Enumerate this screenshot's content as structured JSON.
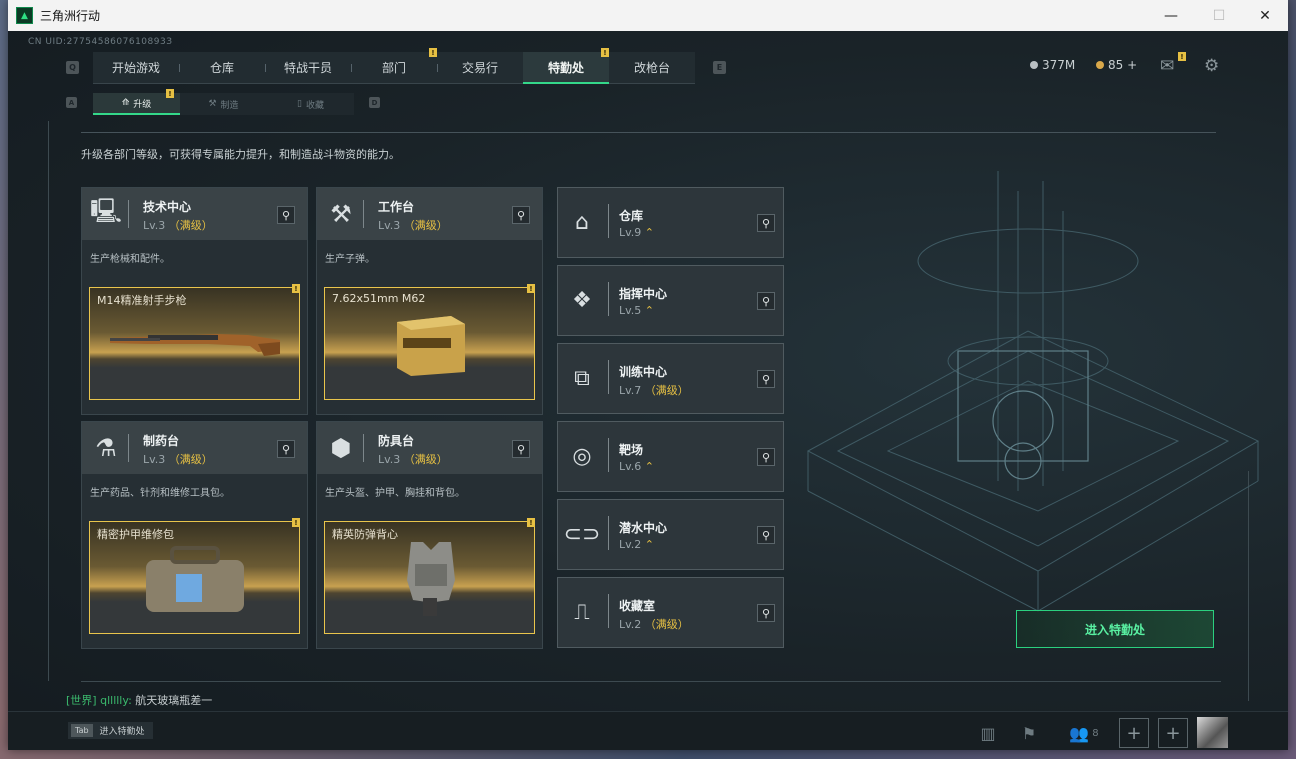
{
  "window": {
    "title": "三角洲行动",
    "controls": {
      "minimize": "—",
      "maximize": "☐",
      "close": "✕"
    }
  },
  "uid": "CN UID:2775458607610893З",
  "top_nav": {
    "left_key": "Q",
    "right_key": "E",
    "tabs": [
      {
        "label": "开始游戏",
        "active": false,
        "badge": ""
      },
      {
        "label": "仓库",
        "active": false,
        "badge": ""
      },
      {
        "label": "特战干员",
        "active": false,
        "badge": ""
      },
      {
        "label": "部门",
        "active": false,
        "badge": "!"
      },
      {
        "label": "交易行",
        "active": false,
        "badge": ""
      },
      {
        "label": "特勤处",
        "active": true,
        "badge": "!"
      },
      {
        "label": "改枪台",
        "active": false,
        "badge": ""
      }
    ]
  },
  "sub_nav": {
    "left_key": "A",
    "right_key": "D",
    "tabs": [
      {
        "label": "升级",
        "active": true,
        "badge": "!"
      },
      {
        "label": "制造",
        "active": false
      },
      {
        "label": "收藏",
        "active": false
      }
    ]
  },
  "currency": {
    "coins": "377M",
    "tokens": "85 +"
  },
  "mail_badge": "!",
  "description": "升级各部门等级，可获得专属能力提升，和制造战斗物资的能力。",
  "workshops": [
    {
      "name": "技术中心",
      "level": "Lv.3",
      "max_label": "（满级）",
      "desc": "生产枪械和配件。",
      "product": "M14精准射手步枪",
      "badge": "!"
    },
    {
      "name": "工作台",
      "level": "Lv.3",
      "max_label": "（满级）",
      "desc": "生产子弹。",
      "product": "7.62x51mm M62",
      "badge": "!"
    },
    {
      "name": "制药台",
      "level": "Lv.3",
      "max_label": "（满级）",
      "desc": "生产药品、针剂和维修工具包。",
      "product": "精密护甲维修包",
      "badge": "!"
    },
    {
      "name": "防具台",
      "level": "Lv.3",
      "max_label": "（满级）",
      "desc": "生产头盔、护甲、胸挂和背包。",
      "product": "精英防弹背心",
      "badge": "!"
    }
  ],
  "facilities": [
    {
      "name": "仓库",
      "level": "Lv.9",
      "suffix": "⌃"
    },
    {
      "name": "指挥中心",
      "level": "Lv.5",
      "suffix": "⌃"
    },
    {
      "name": "训练中心",
      "level": "Lv.7",
      "suffix": "（满级）"
    },
    {
      "name": "靶场",
      "level": "Lv.6",
      "suffix": "⌃"
    },
    {
      "name": "潜水中心",
      "level": "Lv.2",
      "suffix": "⌃"
    },
    {
      "name": "收藏室",
      "level": "Lv.2",
      "suffix": "（满级）"
    }
  ],
  "enter_button": "进入特勤处",
  "chat": {
    "channel": "[世界]",
    "user": "qllllly",
    "message": "航天玻璃瓶差一"
  },
  "bottom": {
    "tab_key": "Tab",
    "tab_hint": "进入特勤处",
    "friends_count": "8"
  },
  "colors": {
    "accent": "#34d88a",
    "badge": "#e6c043",
    "max_level": "#e6c043"
  }
}
